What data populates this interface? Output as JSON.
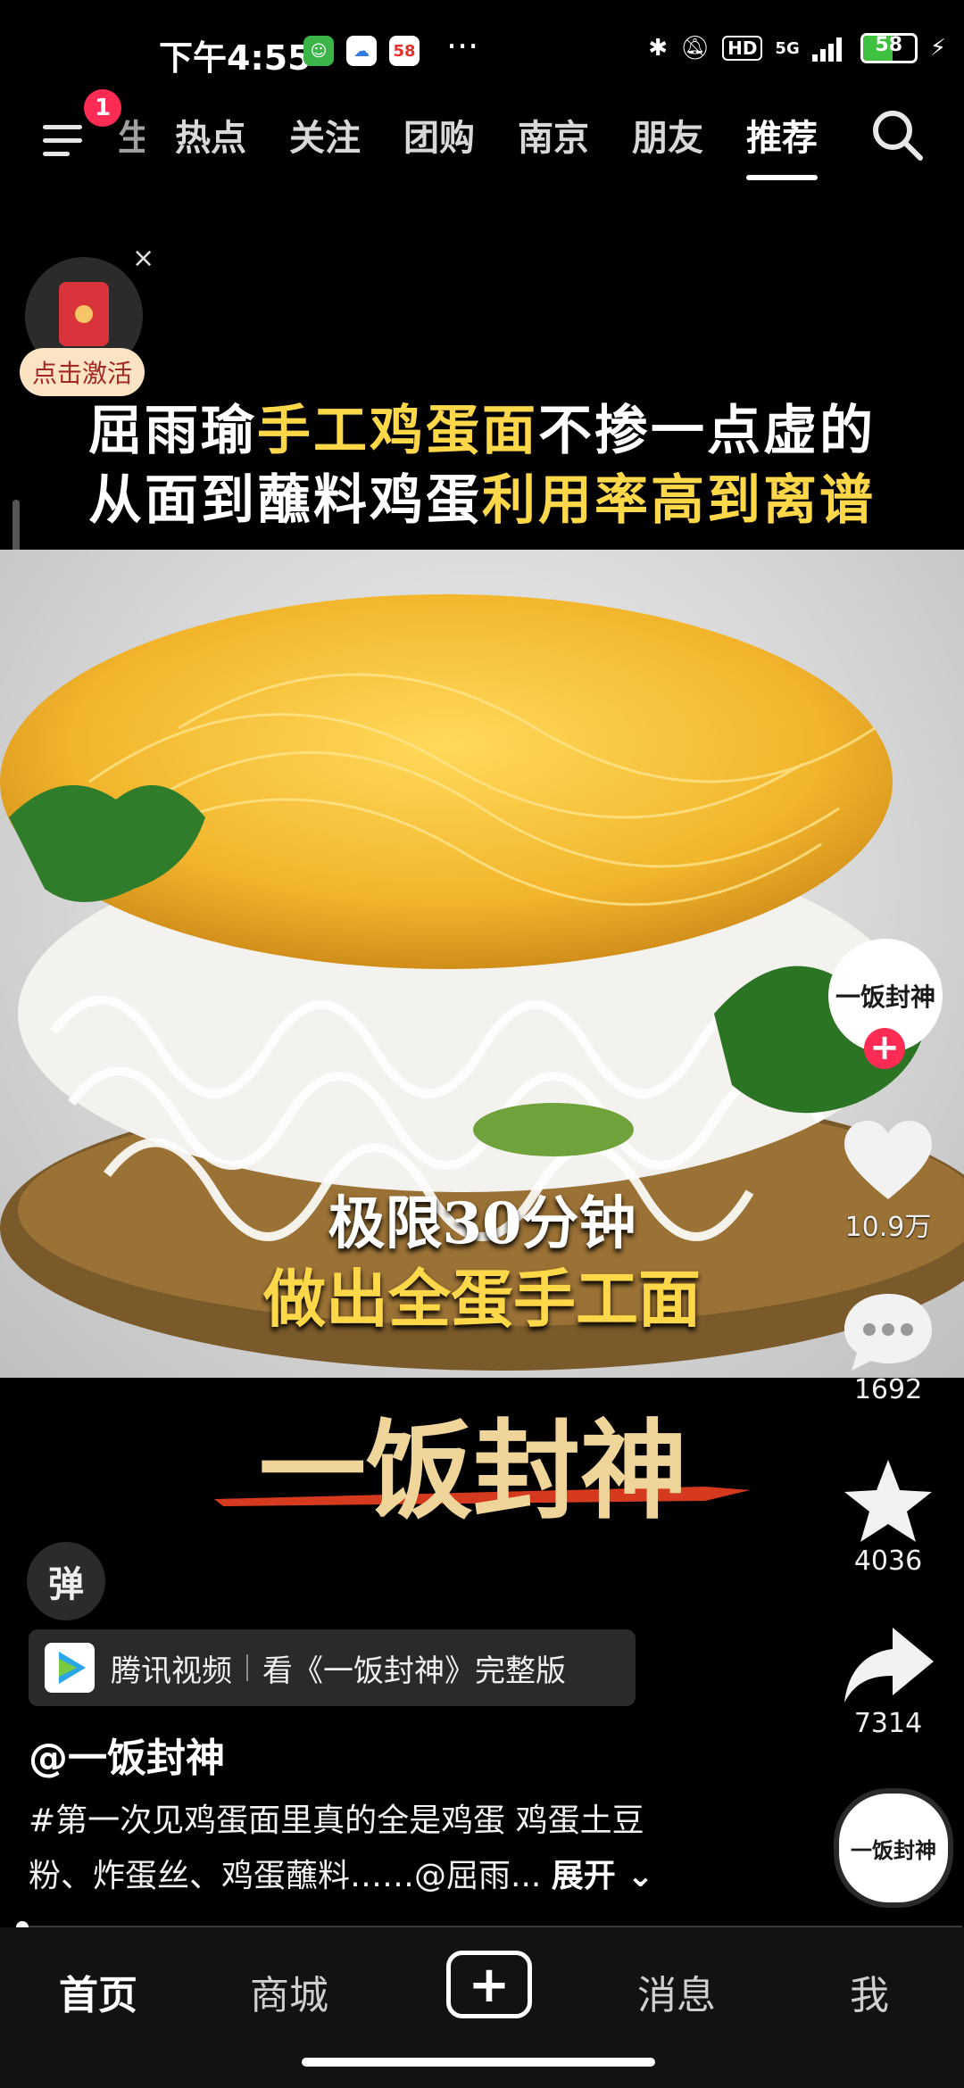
{
  "status_bar": {
    "time": "下午4:55",
    "app58": "58",
    "more": "···",
    "hd": "HD",
    "network": "5G",
    "battery_level": "58",
    "battery_fraction": 0.58,
    "icons": [
      "wechat-app-icon",
      "cloud-app-icon",
      "app58-icon",
      "bluetooth-icon",
      "mute-bell-icon",
      "signal-icon",
      "charging-icon"
    ]
  },
  "top_nav": {
    "badge": "1",
    "tabs": [
      {
        "label": "生",
        "partial": true
      },
      {
        "label": "热点"
      },
      {
        "label": "关注"
      },
      {
        "label": "团购"
      },
      {
        "label": "南京"
      },
      {
        "label": "朋友"
      },
      {
        "label": "推荐",
        "active": true
      }
    ]
  },
  "red_packet": {
    "close": "×",
    "label": "点击激活"
  },
  "headline": {
    "line1": [
      {
        "t": "屈雨瑜",
        "y": false
      },
      {
        "t": "手工鸡蛋面",
        "y": true
      },
      {
        "t": "不掺一点虚的",
        "y": false
      }
    ],
    "line2": [
      {
        "t": "从面到蘸料鸡蛋",
        "y": false
      },
      {
        "t": "利用率高到离谱",
        "y": true
      }
    ]
  },
  "video": {
    "caption1": "极限30分钟",
    "caption2": "做出全蛋手工面",
    "brand": "一饭封神"
  },
  "right_rail": {
    "avatar_text": "一饭封神",
    "follow": "+",
    "likes": "10.9万",
    "comments": "1692",
    "favorites": "4036",
    "shares": "7314",
    "music_text": "一饭封神"
  },
  "danmaku_label": "弹",
  "ad_bar": {
    "app": "腾讯视频",
    "text": "看《一饭封神》完整版"
  },
  "author": "@一饭封神",
  "description": {
    "line1": "#第一次见鸡蛋面里真的全是鸡蛋 鸡蛋土豆",
    "line2": "粉、炸蛋丝、鸡蛋蘸料……@屈雨...",
    "more": "展开"
  },
  "bottom_nav": {
    "home": "首页",
    "mall": "商城",
    "create": "+",
    "messages": "消息",
    "me": "我"
  },
  "colors": {
    "accent": "#fe2c55",
    "highlight": "#ffd84a",
    "background": "#000000"
  }
}
